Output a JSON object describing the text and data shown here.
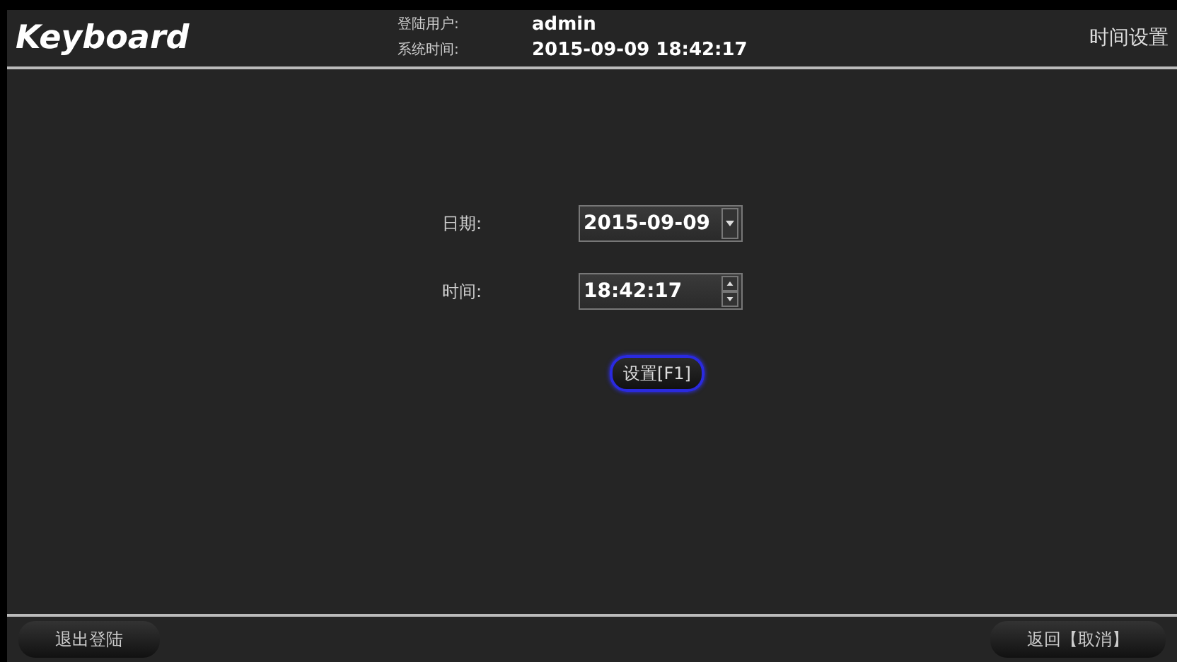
{
  "header": {
    "title": "Keyboard",
    "user_label": "登陆用户:",
    "user": "admin",
    "time_label": "系统时间:",
    "time": "2015-09-09 18:42:17",
    "page_title": "时间设置"
  },
  "form": {
    "fields": [
      {
        "kind": "dropdown",
        "label": "日期:",
        "value": "2015-09-09"
      },
      {
        "kind": "spinner",
        "label": "时间:",
        "value": "18:42:17"
      }
    ],
    "button": {
      "label": "设置[F1]",
      "focused": true
    }
  },
  "footer": {
    "left_button": "退出登陆",
    "right_button": "返回【取消】"
  }
}
